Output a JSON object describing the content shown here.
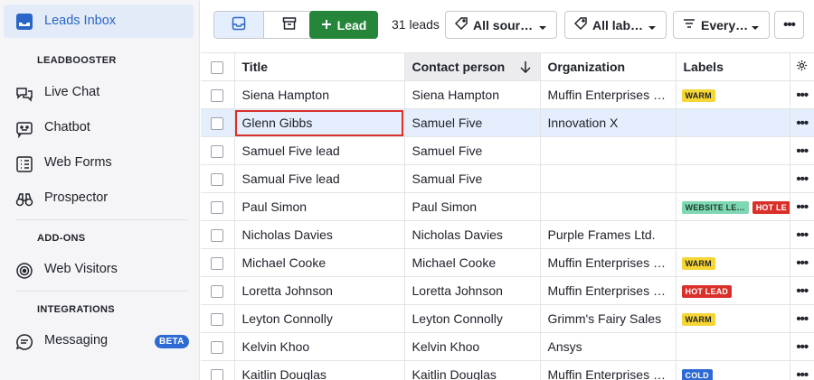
{
  "sidebar": {
    "active": {
      "label": "Leads Inbox",
      "icon": "inbox-icon"
    },
    "sections": [
      {
        "title": "LEADBOOSTER"
      },
      {
        "title": "ADD-ONS"
      },
      {
        "title": "INTEGRATIONS"
      }
    ],
    "items": [
      {
        "label": "Live Chat",
        "icon": "chat-bubbles-icon"
      },
      {
        "label": "Chatbot",
        "icon": "chatbot-icon"
      },
      {
        "label": "Web Forms",
        "icon": "form-list-icon"
      },
      {
        "label": "Prospector",
        "icon": "binoculars-icon"
      },
      {
        "label": "Web Visitors",
        "icon": "radar-icon"
      },
      {
        "label": "Messaging",
        "icon": "message-icon",
        "badge": "BETA"
      }
    ]
  },
  "toolbar": {
    "add_lead_label": "Lead",
    "lead_count": "31 leads",
    "filters": [
      {
        "label": "All sour…",
        "icon": "tag-icon"
      },
      {
        "label": "All lab…",
        "icon": "tag-icon"
      },
      {
        "label": "Every…",
        "icon": "filter-lines-icon"
      }
    ]
  },
  "table": {
    "columns": [
      "Title",
      "Contact person",
      "Organization",
      "Labels"
    ],
    "rows": [
      {
        "title": "Siena Hampton",
        "contact": "Siena Hampton",
        "org": "Muffin Enterprises …",
        "labels": [
          {
            "text": "WARM",
            "bg": "#f6d634",
            "fg": "#21232c"
          }
        ]
      },
      {
        "title": "Glenn Gibbs",
        "contact": "Samuel Five",
        "org": "Innovation X",
        "labels": []
      },
      {
        "title": "Samuel Five lead",
        "contact": "Samuel Five",
        "org": "",
        "labels": []
      },
      {
        "title": "Samual Five lead",
        "contact": "Samual Five",
        "org": "",
        "labels": []
      },
      {
        "title": "Paul Simon",
        "contact": "Paul Simon",
        "org": "",
        "labels": [
          {
            "text": "WEBSITE LE…",
            "bg": "#7fd8b4",
            "fg": "#1d3a2c"
          },
          {
            "text": "HOT LE",
            "bg": "#d9302a",
            "fg": "#ffffff"
          }
        ]
      },
      {
        "title": "Nicholas Davies",
        "contact": "Nicholas Davies",
        "org": "Purple Frames Ltd.",
        "labels": []
      },
      {
        "title": "Michael Cooke",
        "contact": "Michael Cooke",
        "org": "Muffin Enterprises …",
        "labels": [
          {
            "text": "WARM",
            "bg": "#f6d634",
            "fg": "#21232c"
          }
        ]
      },
      {
        "title": "Loretta Johnson",
        "contact": "Loretta Johnson",
        "org": "Muffin Enterprises …",
        "labels": [
          {
            "text": "HOT LEAD",
            "bg": "#d9302a",
            "fg": "#ffffff"
          }
        ]
      },
      {
        "title": "Leyton Connolly",
        "contact": "Leyton Connolly",
        "org": "Grimm's Fairy Sales",
        "labels": [
          {
            "text": "WARM",
            "bg": "#f6d634",
            "fg": "#21232c"
          }
        ]
      },
      {
        "title": "Kelvin Khoo",
        "contact": "Kelvin Khoo",
        "org": "Ansys",
        "labels": []
      },
      {
        "title": "Kaitlin Douglas",
        "contact": "Kaitlin Douglas",
        "org": "Muffin Enterprises …",
        "labels": [
          {
            "text": "COLD",
            "bg": "#2d6ad5",
            "fg": "#ffffff"
          }
        ]
      }
    ]
  },
  "colors": {
    "accent": "#2a65c8",
    "primary_button": "#25863a",
    "selected_row": "#e5eefc",
    "focus_outline": "#d9302a"
  }
}
